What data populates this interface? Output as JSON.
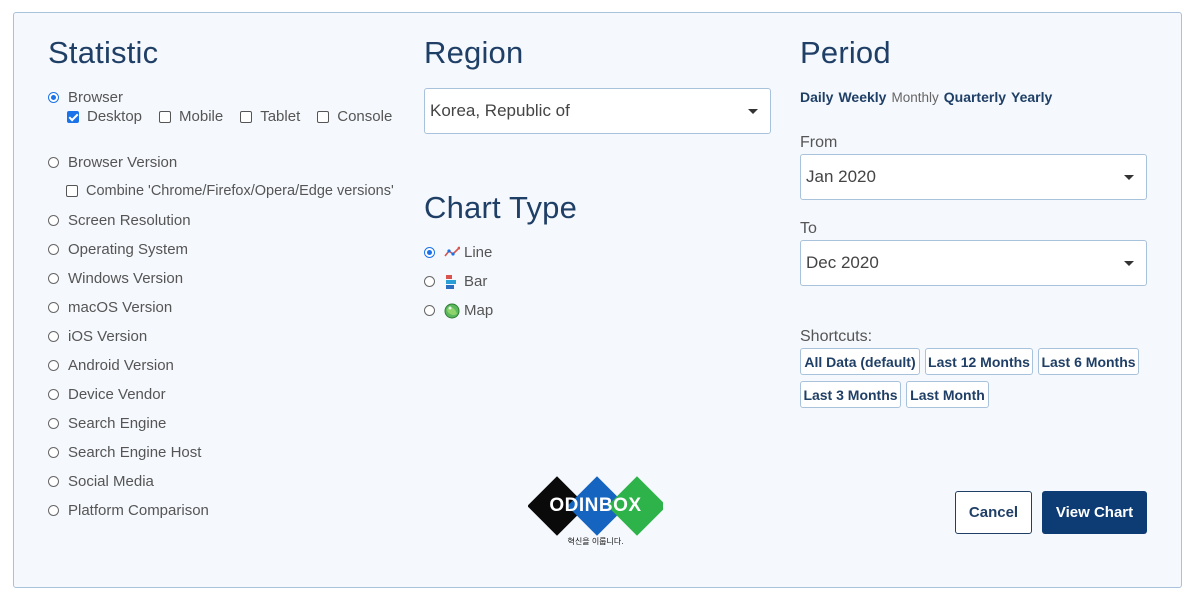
{
  "statistic": {
    "heading": "Statistic",
    "browser_label": "Browser",
    "platforms": [
      {
        "label": "Desktop",
        "checked": true
      },
      {
        "label": "Mobile",
        "checked": false
      },
      {
        "label": "Tablet",
        "checked": false
      },
      {
        "label": "Console",
        "checked": false
      }
    ],
    "browser_version_label": "Browser Version",
    "combine_label": "Combine 'Chrome/Firefox/Opera/Edge versions'",
    "options": [
      "Screen Resolution",
      "Operating System",
      "Windows Version",
      "macOS Version",
      "iOS Version",
      "Android Version",
      "Device Vendor",
      "Search Engine",
      "Search Engine Host",
      "Social Media",
      "Platform Comparison"
    ]
  },
  "region": {
    "heading": "Region",
    "selected": "Korea, Republic of"
  },
  "chart_type": {
    "heading": "Chart Type",
    "options": [
      {
        "label": "Line",
        "icon": "line-chart-icon",
        "selected": true
      },
      {
        "label": "Bar",
        "icon": "bar-chart-icon",
        "selected": false
      },
      {
        "label": "Map",
        "icon": "globe-icon",
        "selected": false
      }
    ]
  },
  "period": {
    "heading": "Period",
    "granularity": [
      "Daily",
      "Weekly",
      "Monthly",
      "Quarterly",
      "Yearly"
    ],
    "current": "Monthly",
    "from_label": "From",
    "from_value": "Jan 2020",
    "to_label": "To",
    "to_value": "Dec 2020",
    "shortcuts_label": "Shortcuts:",
    "shortcuts": [
      "All Data (default)",
      "Last 12 Months",
      "Last 6 Months",
      "Last 3 Months",
      "Last Month"
    ]
  },
  "logo": {
    "text": "ODINBOX",
    "tagline": "혁신을 이룹니다."
  },
  "actions": {
    "cancel": "Cancel",
    "view": "View Chart"
  },
  "colors": {
    "accent": "#1f3f66",
    "radio": "#1a73e8",
    "primary_button": "#0d3c74"
  }
}
